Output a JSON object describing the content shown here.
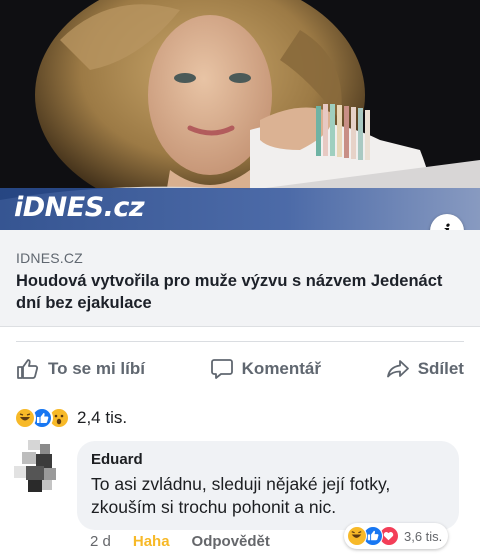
{
  "preview": {
    "brand": "iDNES.cz",
    "info_icon": "info-icon",
    "domain": "IDNES.CZ",
    "title": "Houdová vytvořila pro muže výzvu s názvem Jedenáct dní bez ejakulace"
  },
  "actions": {
    "like": "To se mi líbí",
    "comment": "Komentář",
    "share": "Sdílet"
  },
  "reactions": {
    "icons": [
      "haha-reaction-icon",
      "like-reaction-icon",
      "wow-reaction-icon"
    ],
    "count": "2,4 tis."
  },
  "comment": {
    "author": "Eduard",
    "text": "To asi zvládnu, sleduji nějaké její fotky, zkouším si trochu pohonit a nic.",
    "time": "2 d",
    "reaction_label": "Haha",
    "reply_label": "Odpovědět",
    "reaction_icons": [
      "haha-reaction-icon",
      "like-reaction-icon",
      "love-reaction-icon"
    ],
    "reaction_count": "3,6 tis."
  },
  "colors": {
    "brand_bar": "#2f559c",
    "like_blue": "#1877f2",
    "haha_yellow": "#f7b928",
    "love_red": "#f33e58",
    "muted_text": "#606770"
  }
}
